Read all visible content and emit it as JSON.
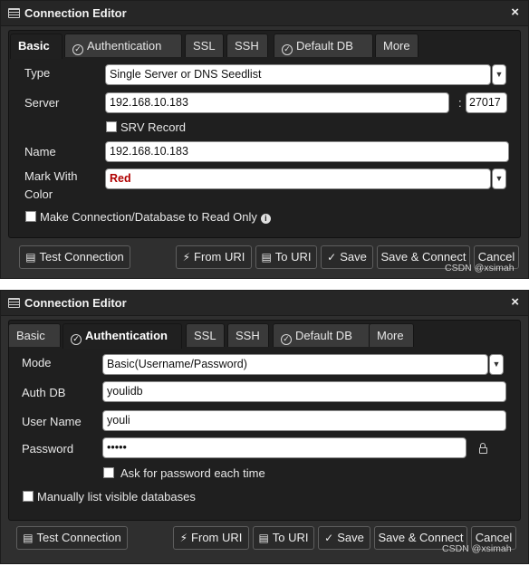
{
  "dialog1": {
    "title": "Connection Editor",
    "tabs": [
      "Basic",
      "Authentication",
      "SSL",
      "SSH",
      "Default DB",
      "More"
    ],
    "type_label": "Type",
    "type_value": "Single Server or DNS Seedlist",
    "server_label": "Server",
    "server_host": "192.168.10.183",
    "server_port": "27017",
    "srv_label": "SRV Record",
    "name_label": "Name",
    "name_value": "192.168.10.183",
    "mark_label_1": "Mark With",
    "mark_label_2": "Color",
    "mark_value": "Red",
    "readonly_label": "Make Connection/Database to Read Only",
    "buttons": {
      "test": "Test Connection",
      "from_uri": "From URI",
      "to_uri": "To URI",
      "save": "Save",
      "save_connect": "Save & Connect",
      "cancel": "Cancel"
    },
    "watermark": "CSDN @xsimah"
  },
  "dialog2": {
    "title": "Connection Editor",
    "tabs": [
      "Basic",
      "Authentication",
      "SSL",
      "SSH",
      "Default DB",
      "More"
    ],
    "mode_label": "Mode",
    "mode_value": "Basic(Username/Password)",
    "authdb_label": "Auth DB",
    "authdb_value": "youlidb",
    "username_label": "User Name",
    "username_value": "youli",
    "password_label": "Password",
    "password_value": "•••••",
    "ask_label": "Ask for password each time",
    "manual_label": "Manually list visible databases",
    "buttons": {
      "test": "Test Connection",
      "from_uri": "From URI",
      "to_uri": "To URI",
      "save": "Save",
      "save_connect": "Save & Connect",
      "cancel": "Cancel"
    },
    "watermark": "CSDN @xsimah"
  },
  "icons": {
    "close": "×",
    "check": "✓",
    "bolt": "⚡",
    "clipboard": "▤",
    "info": "i"
  }
}
